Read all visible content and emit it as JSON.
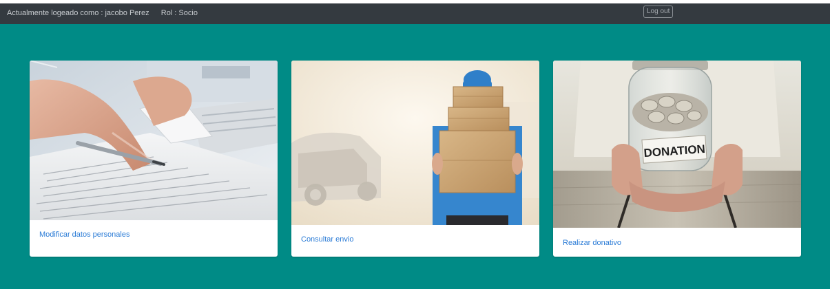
{
  "header": {
    "user_label": "Actualmente logeado como : jacobo Perez",
    "role_label": "Rol : Socio",
    "logout_label": "Log out"
  },
  "cards": [
    {
      "label": "Modificar datos personales",
      "image_icon": "writing-document-photo"
    },
    {
      "label": "Consultar envio",
      "image_icon": "delivery-boxes-photo"
    },
    {
      "label": "Realizar donativo",
      "image_icon": "donation-jar-photo",
      "jar_text": "DONATION"
    }
  ],
  "colors": {
    "page_background": "#008b86",
    "header_background": "#343a40",
    "link": "#2a7bd6"
  }
}
